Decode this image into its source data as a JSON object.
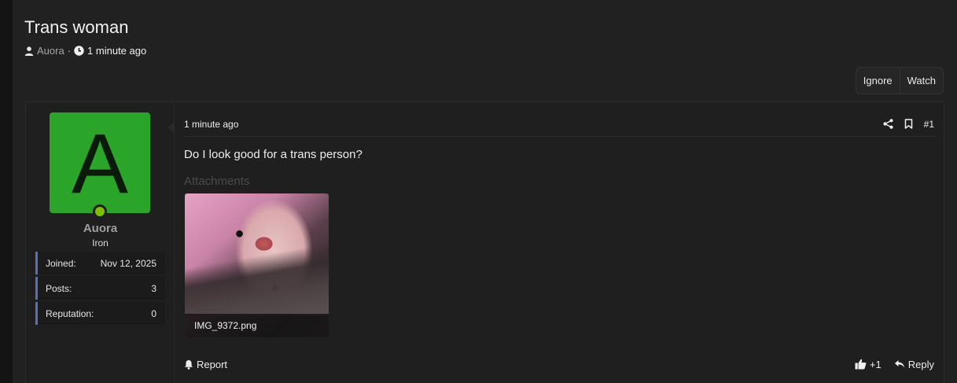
{
  "thread": {
    "title": "Trans woman",
    "author": "Auora",
    "separator": "·",
    "time": "1 minute ago"
  },
  "actions": {
    "ignore": "Ignore",
    "watch": "Watch"
  },
  "user": {
    "avatar_letter": "A",
    "avatar_color": "#2aa52a",
    "online_color": "#7bbf00",
    "name": "Auora",
    "title": "Iron",
    "stats": [
      {
        "label": "Joined:",
        "value": "Nov 12, 2025"
      },
      {
        "label": "Posts:",
        "value": "3"
      },
      {
        "label": "Reputation:",
        "value": "0"
      }
    ]
  },
  "post": {
    "date": "1 minute ago",
    "number": "#1",
    "body": "Do I look good for a trans person?",
    "attachments_label": "Attachments",
    "attachment_name": "IMG_9372.png",
    "report": "Report",
    "reactions": "+1",
    "reply": "Reply"
  }
}
